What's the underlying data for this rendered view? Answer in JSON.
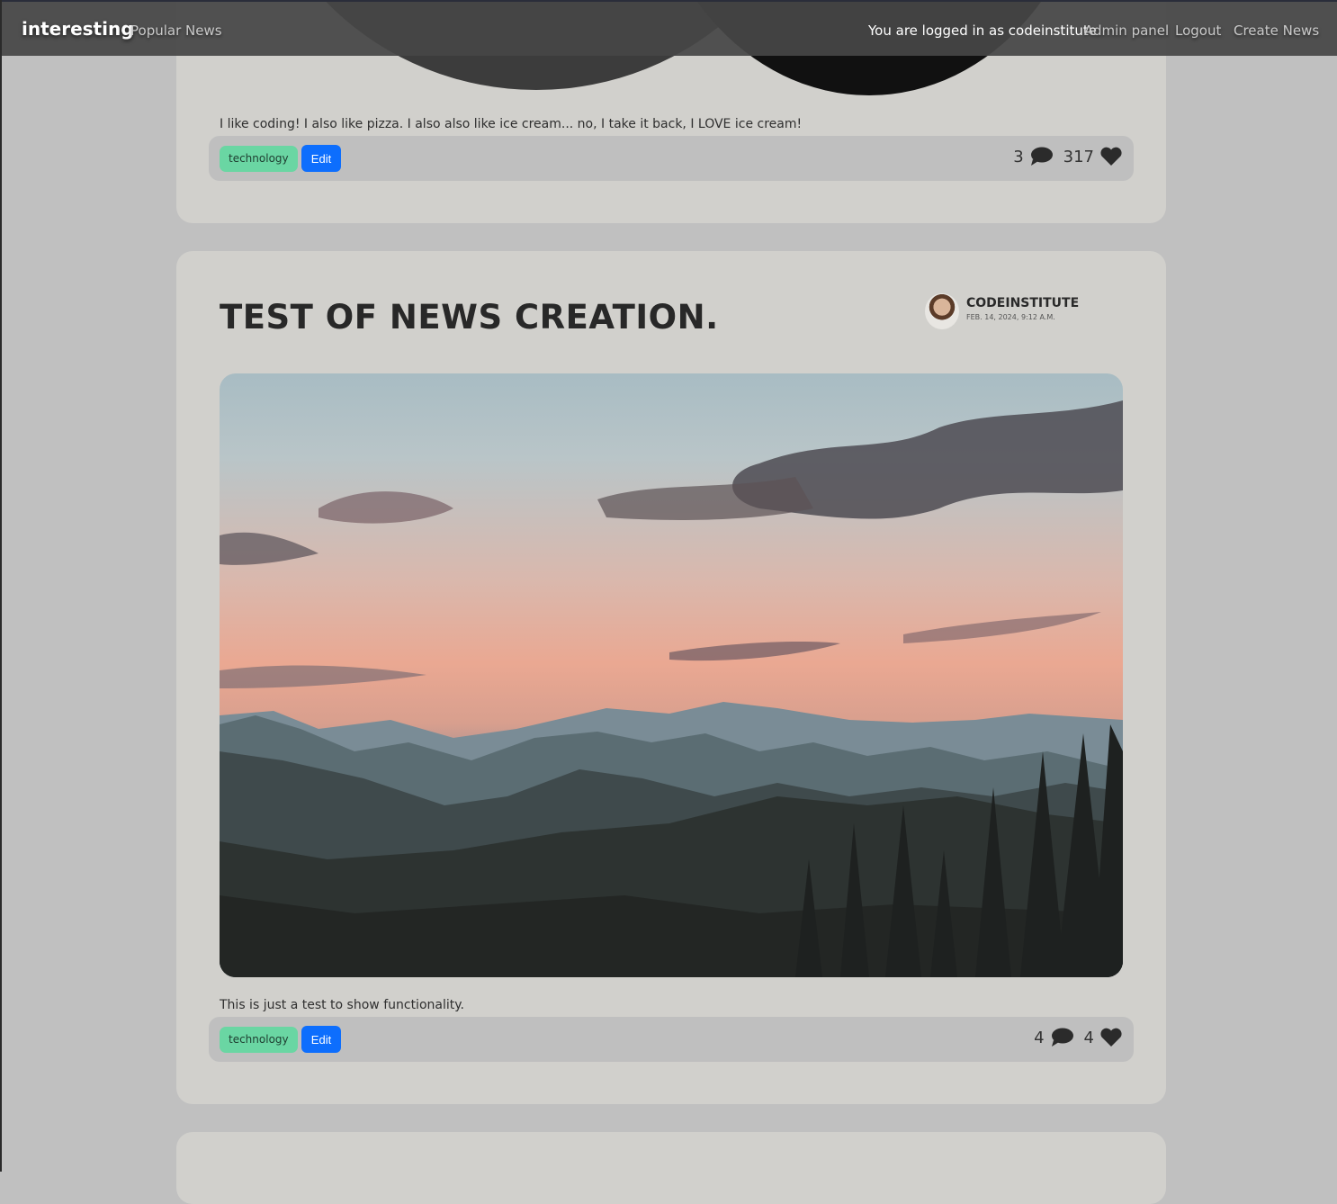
{
  "navbar": {
    "brand": "interesting",
    "popular": "Popular News",
    "logged_in_text": "You are logged in as codeinstitute",
    "admin": "Admin panel",
    "logout": "Logout",
    "create": "Create News"
  },
  "posts": [
    {
      "excerpt": "I like coding! I also like pizza. I also also like ice cream... no, I take it back, I LOVE ice cream!",
      "tag": "technology",
      "edit": "Edit",
      "comments": "3",
      "likes": "317"
    },
    {
      "title": "TEST OF NEWS CREATION.",
      "author": "CODEINSTITUTE",
      "date": "FEB. 14, 2024, 9:12 A.M.",
      "image_icon": "landscape-sunset-image",
      "excerpt": "This is just a test to show functionality.",
      "tag": "technology",
      "edit": "Edit",
      "comments": "4",
      "likes": "4"
    }
  ],
  "icons": {
    "comment": "comment-icon",
    "heart": "heart-icon"
  },
  "colors": {
    "tag_bg": "#6ad6a3",
    "edit_bg": "#0d6efd",
    "card_bg": "#d1d0cc",
    "page_bg": "#c0c0c0"
  }
}
